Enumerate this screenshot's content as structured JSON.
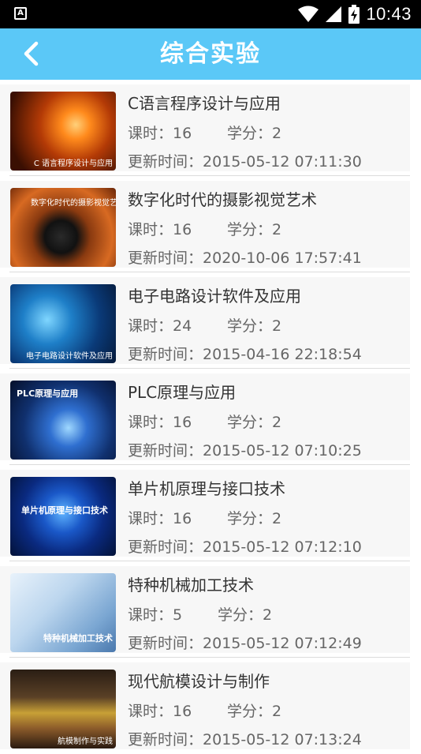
{
  "status_bar": {
    "left_icon": "A",
    "time": "10:43",
    "icons": [
      "wifi-icon",
      "signal-icon",
      "battery-charging-icon"
    ]
  },
  "app_bar": {
    "title": "综合实验",
    "back_icon": "chevron-left-icon"
  },
  "colors": {
    "app_bar": "#5bc8f7",
    "status_bar": "#000000"
  },
  "labels": {
    "hours": "课时：",
    "credits": "学分：",
    "updated": "更新时间："
  },
  "courses": [
    {
      "title": "C语言程序设计与应用",
      "hours": "16",
      "credits": "2",
      "updated": "2015-05-12 07:11:30",
      "thumb_text": "C 语言程序设计与应用"
    },
    {
      "title": "数字化时代的摄影视觉艺术",
      "hours": "16",
      "credits": "2",
      "updated": "2020-10-06 17:57:41",
      "thumb_text": "数字化时代的摄影视觉艺术"
    },
    {
      "title": "电子电路设计软件及应用",
      "hours": "24",
      "credits": "2",
      "updated": "2015-04-16 22:18:54",
      "thumb_text": "电子电路设计软件及应用"
    },
    {
      "title": "PLC原理与应用",
      "hours": "16",
      "credits": "2",
      "updated": "2015-05-12 07:10:25",
      "thumb_text": "PLC原理与应用"
    },
    {
      "title": "单片机原理与接口技术",
      "hours": "16",
      "credits": "2",
      "updated": "2015-05-12 07:12:10",
      "thumb_text": "单片机原理与接口技术"
    },
    {
      "title": "特种机械加工技术",
      "hours": "5",
      "credits": "2",
      "updated": "2015-05-12 07:12:49",
      "thumb_text": "特种机械加工技术"
    },
    {
      "title": "现代航模设计与制作",
      "hours": "16",
      "credits": "2",
      "updated": "2015-05-12 07:13:24",
      "thumb_text": "航模制作与实践"
    }
  ]
}
